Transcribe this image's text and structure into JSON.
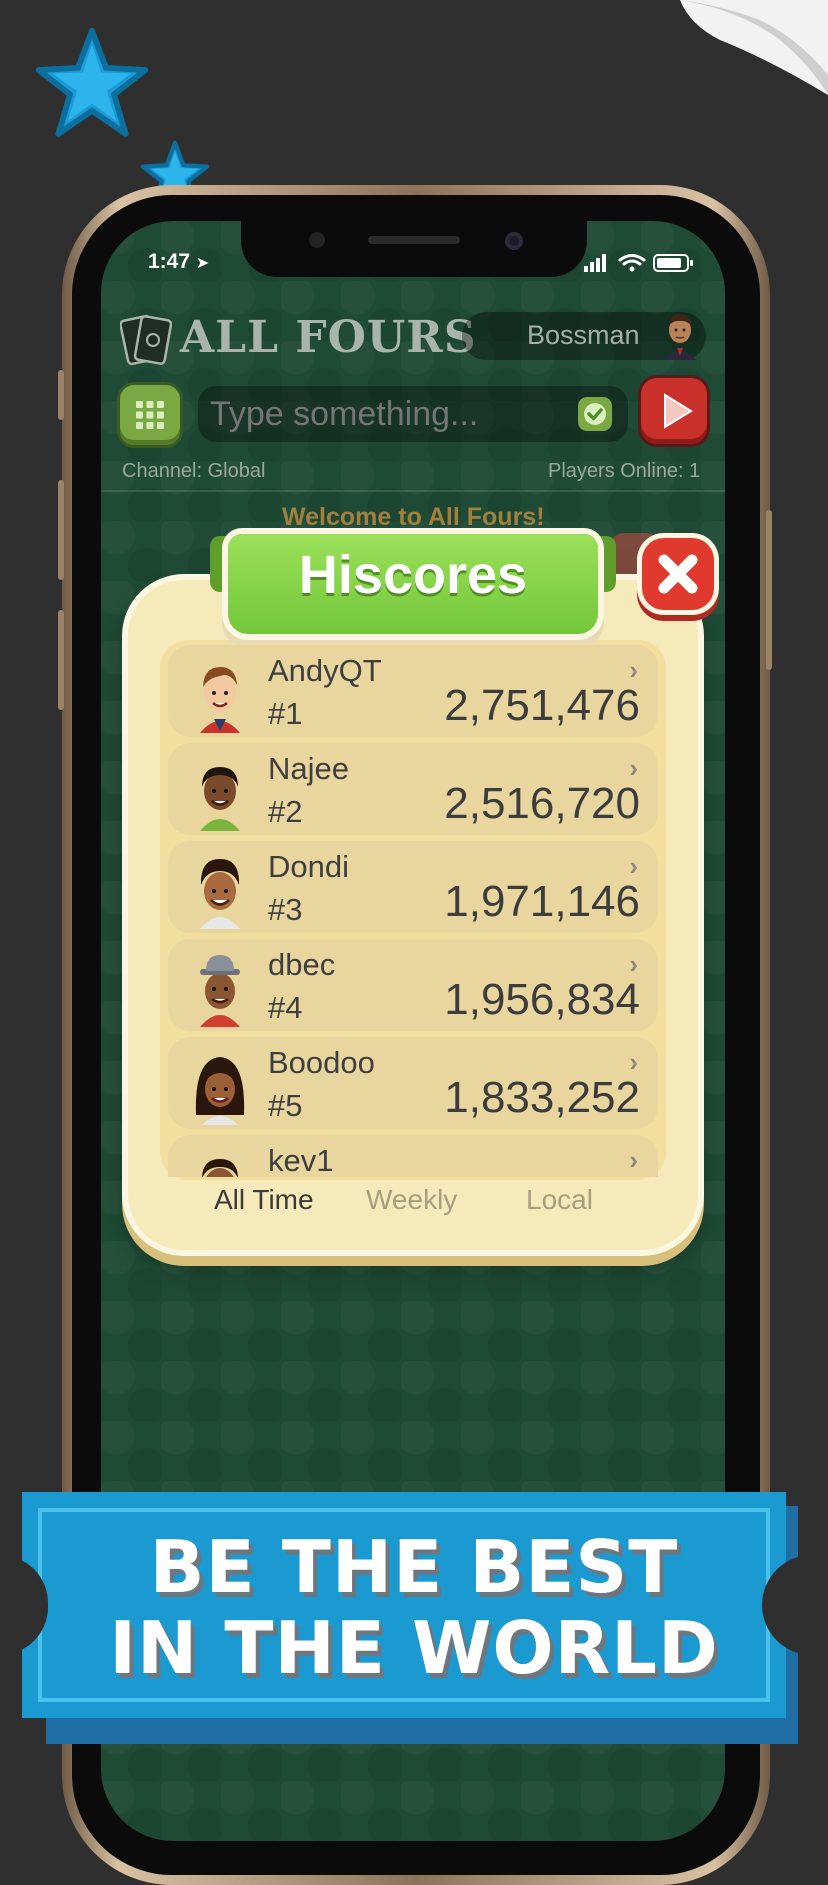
{
  "status_bar": {
    "time": "1:47",
    "icons": "signal-wifi-battery"
  },
  "header": {
    "app_title": "ALL FOURS",
    "username": "Bossman"
  },
  "chat": {
    "placeholder": "Type something...",
    "channel": "Channel: Global",
    "players_online": "Players Online: 1",
    "welcome": "Welcome to All Fours!"
  },
  "hiscores": {
    "title": "Hiscores",
    "rows": [
      {
        "name": "AndyQT",
        "rank": "#1",
        "score": "2,751,476"
      },
      {
        "name": "Najee",
        "rank": "#2",
        "score": "2,516,720"
      },
      {
        "name": "Dondi",
        "rank": "#3",
        "score": "1,971,146"
      },
      {
        "name": "dbec",
        "rank": "#4",
        "score": "1,956,834"
      },
      {
        "name": "Boodoo",
        "rank": "#5",
        "score": "1,833,252"
      },
      {
        "name": "kev1",
        "rank": "",
        "score": ""
      }
    ],
    "tabs": {
      "all_time": "All Time",
      "weekly": "Weekly",
      "local": "Local"
    },
    "selected_tab": "All Time"
  },
  "banner": {
    "line1": "BE THE BEST",
    "line2": "IN THE WORLD"
  },
  "colors": {
    "background": "#2f2f2f",
    "felt": "#1f4a35",
    "panel": "#f6eaba",
    "title_green": "#73c73a",
    "close_red": "#e03a2e",
    "banner_blue": "#1b9ad2",
    "star_blue": "#1a9ad6"
  }
}
